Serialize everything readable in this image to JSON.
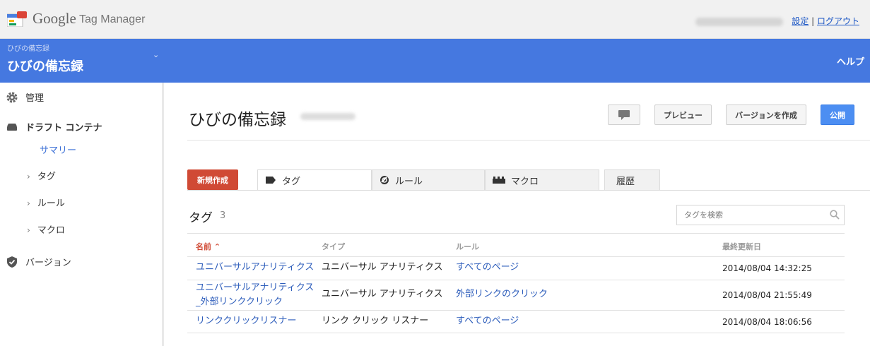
{
  "app": {
    "logo_google": "Google",
    "logo_product": "Tag Manager"
  },
  "account": {
    "settings_label": "設定",
    "separator": "|",
    "logout_label": "ログアウト"
  },
  "container_bar": {
    "label": "ひびの備忘録",
    "name": "ひびの備忘録",
    "caret": "⌄",
    "help_label": "ヘルプ"
  },
  "sidebar": {
    "admin_label": "管理",
    "draft_label": "ドラフト コンテナ",
    "summary_label": "サマリー",
    "tags_label": "タグ",
    "rules_label": "ルール",
    "macros_label": "マクロ",
    "versions_label": "バージョン",
    "chevron": "›"
  },
  "header": {
    "title": "ひびの備忘録",
    "preview_label": "プレビュー",
    "create_version_label": "バージョンを作成",
    "publish_label": "公開"
  },
  "toolbar": {
    "new_label": "新規作成",
    "tabs": [
      {
        "label": "タグ"
      },
      {
        "label": "ルール"
      },
      {
        "label": "マクロ"
      },
      {
        "label": "履歴"
      }
    ]
  },
  "section": {
    "title": "タグ",
    "count": "3",
    "search_placeholder": "タグを検索"
  },
  "table": {
    "columns": {
      "name": "名前",
      "sort_indicator": "⌃",
      "type": "タイプ",
      "rule": "ルール",
      "updated": "最終更新日"
    },
    "rows": [
      {
        "name": "ユニバーサルアナリティクス",
        "type": "ユニバーサル アナリティクス",
        "rule": "すべてのページ",
        "updated": "2014/08/04 14:32:25"
      },
      {
        "name": "ユニバーサルアナリティクス_外部リンククリック",
        "type": "ユニバーサル アナリティクス",
        "rule": "外部リンクのクリック",
        "updated": "2014/08/04 21:55:49"
      },
      {
        "name": "リンククリックリスナー",
        "type": "リンク クリック リスナー",
        "rule": "すべてのページ",
        "updated": "2014/08/04 18:06:56"
      }
    ]
  },
  "colors": {
    "brand_blue": "#4578e0",
    "new_button_red": "#d04a35",
    "publish_blue": "#4c8ef2",
    "link_blue": "#2d5dbb"
  }
}
